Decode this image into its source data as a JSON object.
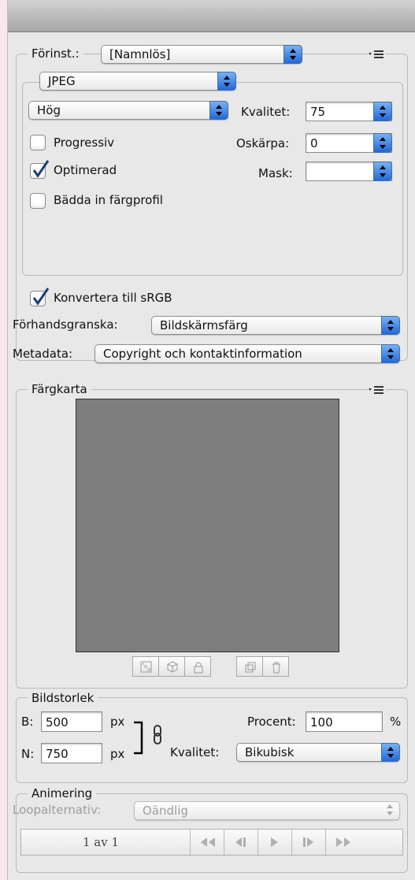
{
  "preset": {
    "label": "Förinst.:",
    "value": "[Namnlös]"
  },
  "format": {
    "value": "JPEG"
  },
  "quality_preset": {
    "value": "Hög"
  },
  "quality": {
    "label": "Kvalitet:",
    "value": "75"
  },
  "blur": {
    "label": "Oskärpa:",
    "value": "0"
  },
  "matte": {
    "label": "Mask:",
    "value": ""
  },
  "options": {
    "progressive": {
      "label": "Progressiv",
      "checked": false
    },
    "optimized": {
      "label": "Optimerad",
      "checked": true
    },
    "embed_profile": {
      "label": "Bädda in färgprofil",
      "checked": false
    },
    "convert_srgb": {
      "label": "Konvertera till sRGB",
      "checked": true
    }
  },
  "preview": {
    "label": "Förhandsgranska:",
    "value": "Bildskärmsfärg"
  },
  "metadata": {
    "label": "Metadata:",
    "value": "Copyright och kontaktinformation"
  },
  "color_table": {
    "title": "Färgkarta",
    "swatch_color": "#7e7e7e"
  },
  "image_size": {
    "title": "Bildstorlek",
    "width_label": "B:",
    "width_value": "500",
    "height_label": "N:",
    "height_value": "750",
    "unit": "px",
    "percent_label": "Procent:",
    "percent_value": "100",
    "percent_unit": "%",
    "quality_label": "Kvalitet:",
    "quality_value": "Bikubisk"
  },
  "animation": {
    "title": "Animering",
    "loop_label": "Loopalternativ:",
    "loop_value": "Oändlig",
    "frame_counter": "1 av 1"
  },
  "colors": {
    "accent": "#2f6fd8",
    "panel": "#e8e8e8",
    "page": "#f7e6ee"
  }
}
